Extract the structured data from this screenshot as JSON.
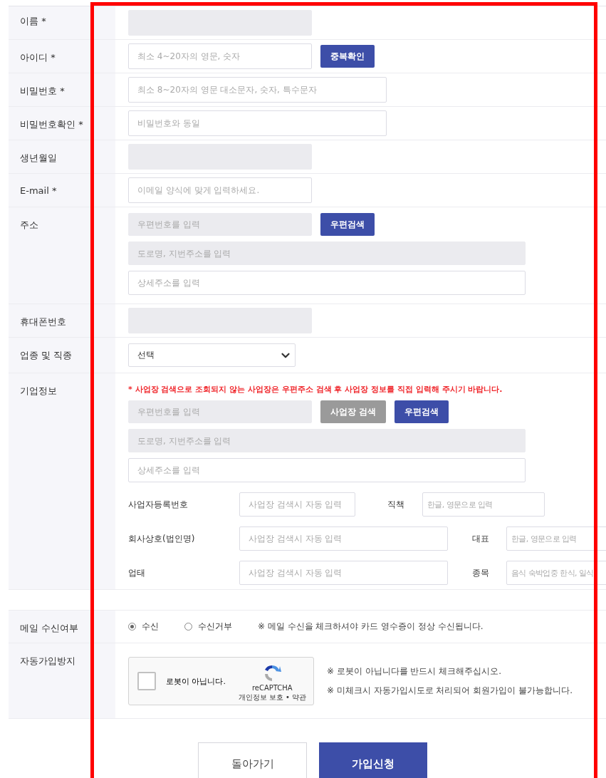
{
  "annotation_frame": true,
  "rows": [
    {
      "kind": "name",
      "label": "이름 *",
      "fields": [
        {
          "readonly": true
        }
      ]
    },
    {
      "kind": "id",
      "label": "아이디 *",
      "fields": [
        {
          "placeholder": "최소 4~20자의 영문, 숫자",
          "readonly": false
        }
      ],
      "button": "중복확인"
    },
    {
      "kind": "password",
      "label": "비밀번호 *",
      "fields": [
        {
          "placeholder": "최소 8~20자의 영문 대소문자, 숫자, 특수문자",
          "readonly": false
        }
      ]
    },
    {
      "kind": "password",
      "label": "비밀번호확인 *",
      "fields": [
        {
          "placeholder": "비밀번호와 동일",
          "readonly": false
        }
      ]
    },
    {
      "kind": "name",
      "label": "생년월일",
      "fields": [
        {
          "readonly": true
        }
      ]
    },
    {
      "kind": "name",
      "label": "E-mail *",
      "fields": [
        {
          "placeholder": "이메일 양식에 맞게 입력하세요.",
          "readonly": false
        }
      ]
    },
    {
      "kind": "address",
      "label": "주소",
      "fields": [
        {
          "placeholder": "우편번호를 입력",
          "readonly": true
        },
        {
          "placeholder": "도로명, 지번주소를 입력",
          "readonly": true
        },
        {
          "placeholder": "상세주소를 입력",
          "readonly": false
        }
      ],
      "button": "우편검색"
    },
    {
      "kind": "name",
      "label": "휴대폰번호",
      "fields": [
        {
          "readonly": true
        }
      ]
    },
    {
      "kind": "select",
      "label": "업종 및 직종",
      "value": "선택"
    },
    {
      "kind": "company",
      "label": "기업정보",
      "notice": "* 사업장 검색으로 조회되지 않는 사업장은 우편주소 검색 후 사업장 정보를 직접 입력해 주시기 바랍니다.",
      "fields": [
        {
          "placeholder": "우편번호를 입력",
          "readonly": true
        },
        {
          "placeholder": "도로명, 지번주소를 입력",
          "readonly": true
        },
        {
          "placeholder": "상세주소를 입력",
          "readonly": false
        }
      ],
      "buttons": [
        {
          "label": "사업장 검색",
          "kind": "secondary"
        },
        {
          "label": "우편검색",
          "kind": "primary"
        }
      ],
      "subrows": [
        {
          "label": "사업자등록번호",
          "placeholder": "사업장 검색시 자동 입력",
          "label_2": "직책",
          "placeholder_2": "한글, 영문으로 입력"
        },
        {
          "label": "회사상호(법인명)",
          "placeholder": "사업장 검색시 자동 입력",
          "label_2": "대표",
          "placeholder_2": "한글, 영문으로 입력"
        },
        {
          "label": "업태",
          "placeholder": "사업장 검색시 자동 입력",
          "label_2": "종목",
          "placeholder_2": "음식 숙박업중 한식, 일식"
        }
      ]
    }
  ],
  "mail_row": {
    "label": "메일 수신여부",
    "options": [
      {
        "label": "수신",
        "selected": true
      },
      {
        "label": "수신거부",
        "selected": false
      }
    ],
    "note": "※ 메일 수신을 체크하셔야 카드 영수증이 정상 수신됩니다."
  },
  "captcha_row": {
    "label": "자동가입방지",
    "checked": false,
    "checkbox_label": "로봇이 아닙니다.",
    "brand": "reCAPTCHA",
    "links": "개인정보 보호 • 약관",
    "notes": [
      "※ 로봇이 아닙니다를 반드시 체크해주십시오.",
      "※ 미체크시 자동가입시도로 처리되어 회원가입이 불가능합니다."
    ]
  },
  "actions": [
    {
      "label": "돌아가기",
      "kind": "secondary"
    },
    {
      "label": "가입신청",
      "kind": "primary"
    }
  ]
}
